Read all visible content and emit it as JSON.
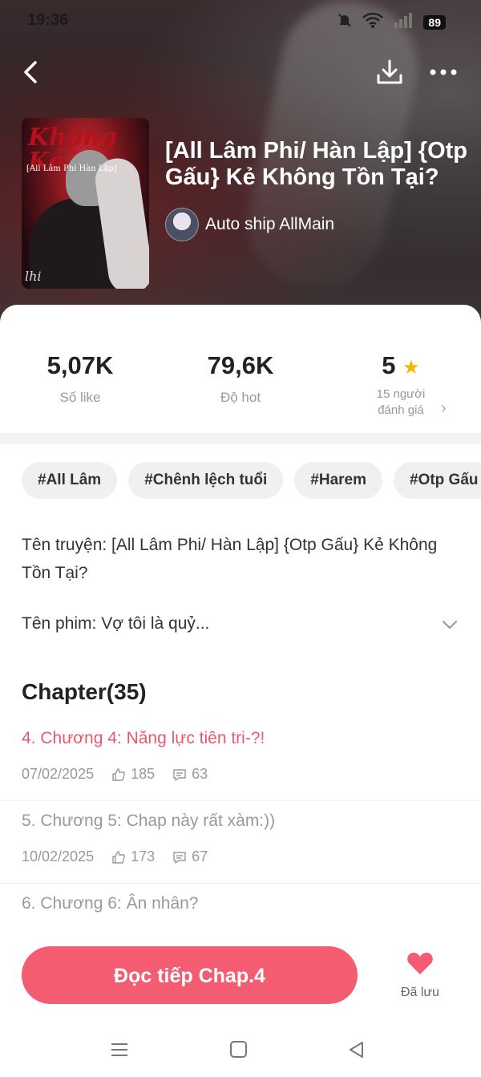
{
  "status": {
    "time": "19:36",
    "battery": "89",
    "icons": [
      "bell-muted-icon",
      "wifi-icon",
      "signal-icon"
    ]
  },
  "header": {
    "title": "[All Lâm Phi/ Hàn Lập] {Otp Gấu} Kẻ Không Tồn Tại?",
    "author": "Auto ship AllMain",
    "cover_art_text": "Không Kẻ",
    "cover_subtitle": "[All Lâm Phi Hàn Lập]",
    "cover_signature": "lhi"
  },
  "stats": {
    "likes_value": "5,07K",
    "likes_label": "Số like",
    "hot_value": "79,6K",
    "hot_label": "Độ hot",
    "rating_value": "5",
    "rating_label_1": "15 người",
    "rating_label_2": "đánh giá"
  },
  "tags": [
    "#All Lâm",
    "#Chênh lệch tuổi",
    "#Harem",
    "#Otp Gấu"
  ],
  "summary": {
    "story_name": "Tên truyện: [All Lâm Phi/ Hàn Lập] {Otp Gấu} Kẻ Không Tồn Tại?",
    "film_name": "Tên phim: Vợ tôi là quỷ..."
  },
  "chapters": {
    "heading": "Chapter(35)",
    "items": [
      {
        "title": "4. Chương 4: Năng lực tiên tri-?!",
        "date": "07/02/2025",
        "likes": "185",
        "comments": "63",
        "active": true
      },
      {
        "title": "5. Chương 5: Chap này rất xàm:))",
        "date": "10/02/2025",
        "likes": "173",
        "comments": "67",
        "active": false
      },
      {
        "title": "6. Chương 6: Ân nhân?",
        "date": "",
        "likes": "",
        "comments": "",
        "active": false
      }
    ]
  },
  "actions": {
    "read_label": "Đọc tiếp Chap.4",
    "saved_label": "Đã lưu"
  },
  "colors": {
    "accent": "#f45c72",
    "active_chapter": "#e8596f",
    "star": "#f7b500"
  }
}
